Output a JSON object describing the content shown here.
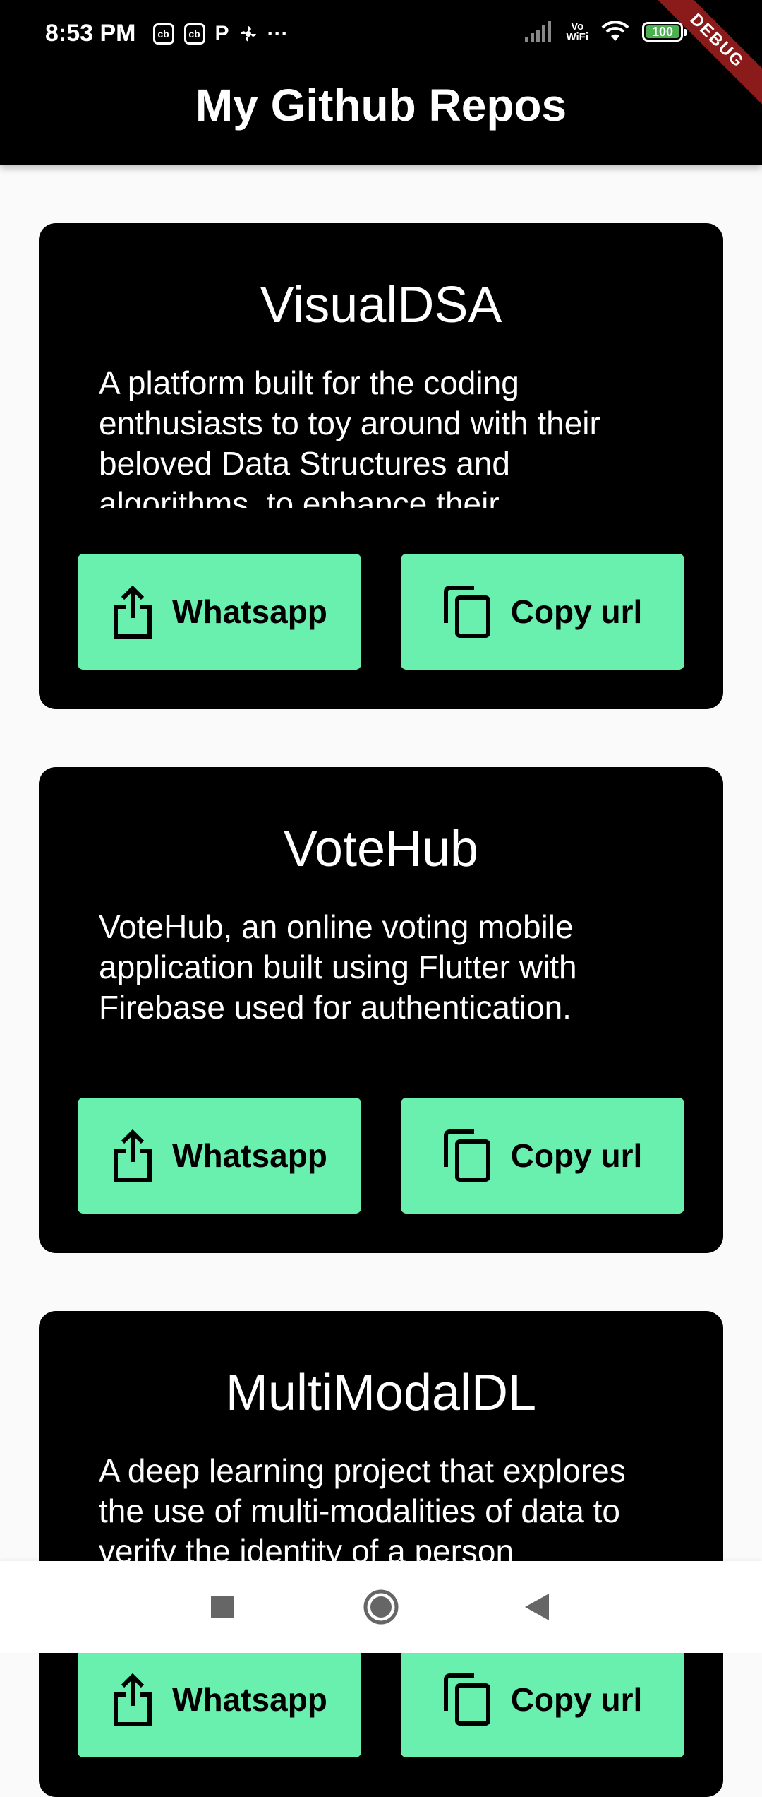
{
  "status_bar": {
    "time": "8:53 PM",
    "left_icons": [
      "cb-icon",
      "cb-icon",
      "p-icon",
      "fan-icon",
      "more-dots-icon"
    ],
    "more_dots": "···",
    "vowifi_top": "Vo",
    "vowifi_bottom": "WiFi",
    "battery": "100",
    "debug_label": "DEBUG"
  },
  "app_bar": {
    "title": "My Github Repos"
  },
  "repos": [
    {
      "name": "VisualDSA",
      "description": "A platform built for the coding enthusiasts to toy around with their beloved Data Structures and algorithms, to enhance their",
      "share_label": "Whatsapp",
      "copy_label": "Copy url"
    },
    {
      "name": "VoteHub",
      "description": "VoteHub, an online voting mobile application built using Flutter with Firebase used for authentication.",
      "share_label": "Whatsapp",
      "copy_label": "Copy url"
    },
    {
      "name": "MultiModalDL",
      "description": "A deep learning project that explores the use of multi-modalities of data to verify the identity of a person",
      "share_label": "Whatsapp",
      "copy_label": "Copy url"
    }
  ],
  "colors": {
    "app_bar": "#000000",
    "card": "#000000",
    "button": "#69F0AE",
    "background": "#FAFAFA",
    "debug_ribbon": "#8B1A1A"
  },
  "nav_icons": [
    "recents-square-icon",
    "home-circle-icon",
    "back-triangle-icon"
  ]
}
